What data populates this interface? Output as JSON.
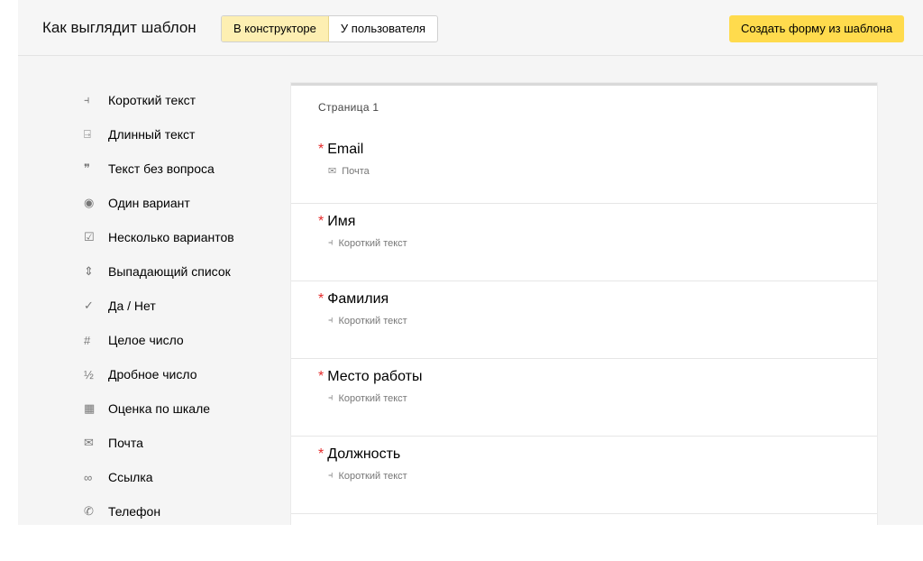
{
  "header": {
    "title": "Как выглядит шаблон",
    "tabs": [
      {
        "label": "В конструкторе",
        "active": true
      },
      {
        "label": "У пользователя",
        "active": false
      }
    ],
    "create_button": "Создать форму из шаблона"
  },
  "sidebar": {
    "items": [
      {
        "label": "Короткий текст",
        "icon": "short-text-icon",
        "glyph": "⫞"
      },
      {
        "label": "Длинный текст",
        "icon": "long-text-icon",
        "glyph": "⍈"
      },
      {
        "label": "Текст без вопроса",
        "icon": "quote-icon",
        "glyph": "❞"
      },
      {
        "label": "Один вариант",
        "icon": "radio-icon",
        "glyph": "◉"
      },
      {
        "label": "Несколько вариантов",
        "icon": "checkbox-icon",
        "glyph": "☑"
      },
      {
        "label": "Выпадающий список",
        "icon": "dropdown-icon",
        "glyph": "⇕"
      },
      {
        "label": "Да / Нет",
        "icon": "check-icon",
        "glyph": "✓"
      },
      {
        "label": "Целое число",
        "icon": "hash-icon",
        "glyph": "#"
      },
      {
        "label": "Дробное число",
        "icon": "fraction-icon",
        "glyph": "½"
      },
      {
        "label": "Оценка по шкале",
        "icon": "grid-icon",
        "glyph": "▦"
      },
      {
        "label": "Почта",
        "icon": "mail-icon",
        "glyph": "✉"
      },
      {
        "label": "Ссылка",
        "icon": "link-icon",
        "glyph": "∞"
      },
      {
        "label": "Телефон",
        "icon": "phone-icon",
        "glyph": "✆"
      }
    ]
  },
  "form": {
    "page_label": "Страница 1",
    "fields": [
      {
        "title": "Email",
        "type": "Почта",
        "required": "*",
        "type_glyph": "✉"
      },
      {
        "title": "Имя",
        "type": "Короткий текст",
        "required": "*",
        "type_glyph": "⫞"
      },
      {
        "title": "Фамилия",
        "type": "Короткий текст",
        "required": "*",
        "type_glyph": "⫞"
      },
      {
        "title": "Место работы",
        "type": "Короткий текст",
        "required": "*",
        "type_glyph": "⫞"
      },
      {
        "title": "Должность",
        "type": "Короткий текст",
        "required": "*",
        "type_glyph": "⫞"
      }
    ]
  },
  "colors": {
    "accent_yellow": "#ffdb4d",
    "active_tab": "#fdefb2",
    "required_star": "#e52b2b"
  }
}
